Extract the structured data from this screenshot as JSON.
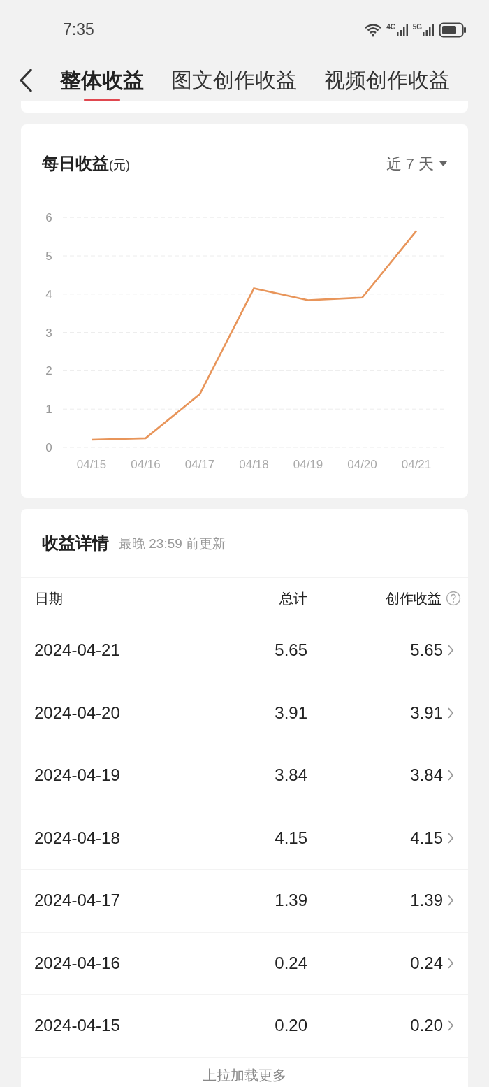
{
  "status_bar": {
    "time": "7:35",
    "network_1": "4G",
    "network_2": "5G"
  },
  "tabs": [
    {
      "label": "整体收益",
      "selected": true
    },
    {
      "label": "图文创作收益",
      "selected": false
    },
    {
      "label": "视频创作收益",
      "selected": false
    }
  ],
  "daily_card": {
    "title": "每日收益",
    "unit": "(元)",
    "range": "近 7 天",
    "chart_data": {
      "type": "line",
      "grid": true,
      "categories": [
        "04/15",
        "04/16",
        "04/17",
        "04/18",
        "04/19",
        "04/20",
        "04/21"
      ],
      "yticks": [
        0,
        1,
        2,
        3,
        4,
        5,
        6
      ],
      "ylim": [
        0,
        6
      ],
      "series": [
        {
          "color": "#e8955a",
          "values": [
            0.2,
            0.24,
            1.39,
            4.15,
            3.84,
            3.91,
            5.65
          ]
        }
      ]
    }
  },
  "details": {
    "title": "收益详情",
    "note": "最晚 23:59 前更新",
    "columns": [
      "日期",
      "总计",
      "创作收益"
    ],
    "rows": [
      {
        "date": "2024-04-21",
        "total": "5.65",
        "creation": "5.65"
      },
      {
        "date": "2024-04-20",
        "total": "3.91",
        "creation": "3.91"
      },
      {
        "date": "2024-04-19",
        "total": "3.84",
        "creation": "3.84"
      },
      {
        "date": "2024-04-18",
        "total": "4.15",
        "creation": "4.15"
      },
      {
        "date": "2024-04-17",
        "total": "1.39",
        "creation": "1.39"
      },
      {
        "date": "2024-04-16",
        "total": "0.24",
        "creation": "0.24"
      },
      {
        "date": "2024-04-15",
        "total": "0.20",
        "creation": "0.20"
      }
    ],
    "footer": "上拉加载更多"
  }
}
